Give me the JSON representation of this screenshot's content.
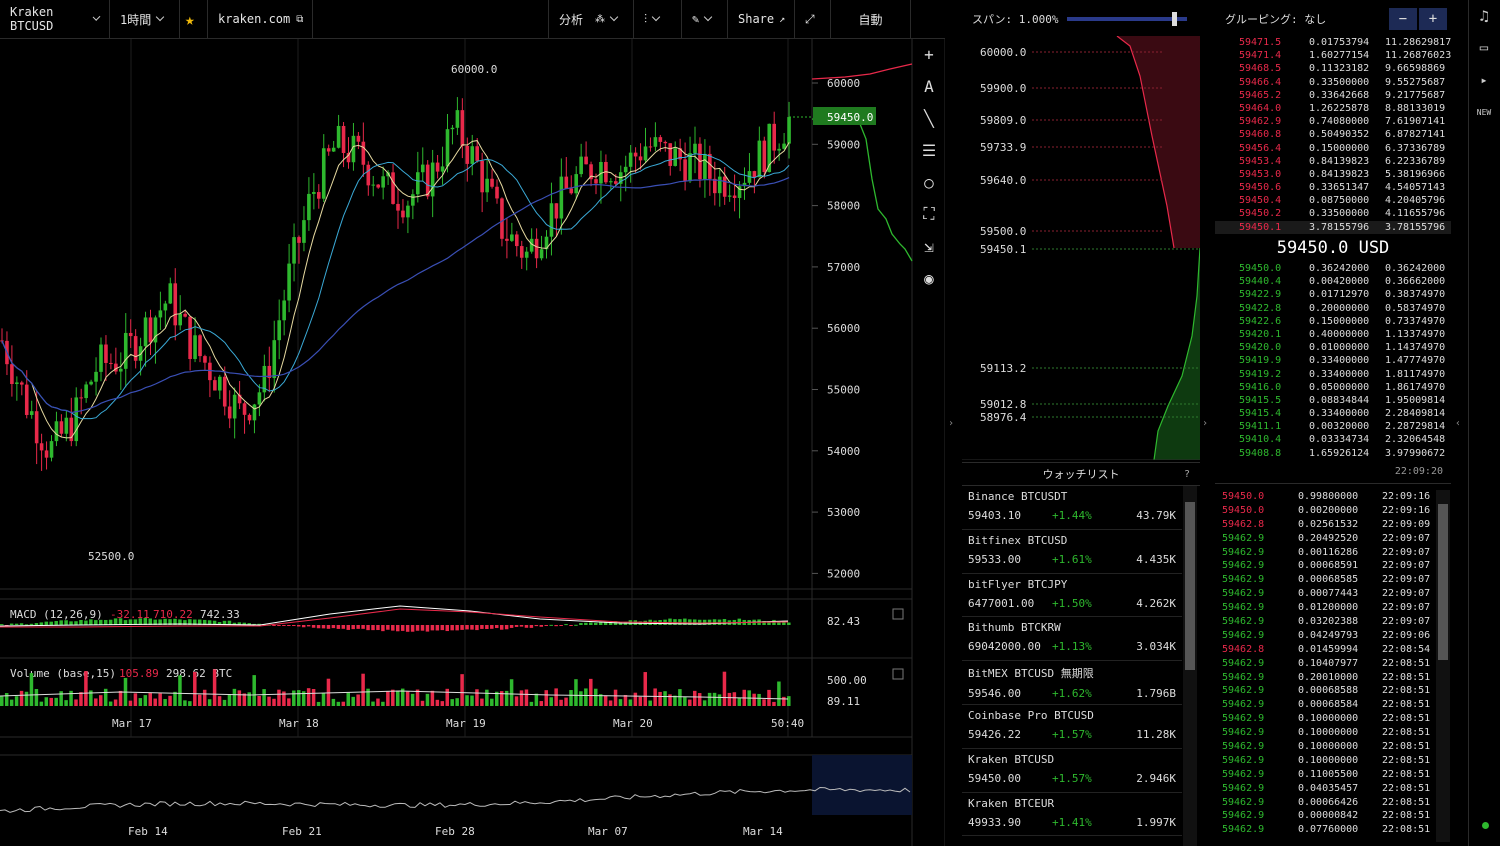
{
  "toolbar": {
    "symbol": "Kraken BTCUSD",
    "interval": "1時間",
    "source": "kraken.com",
    "analysis": "分析",
    "share": "Share",
    "auto": "自動"
  },
  "price_axis": [
    "60000",
    "59000",
    "58000",
    "57000",
    "56000",
    "55000",
    "54000",
    "53000",
    "52000"
  ],
  "last_price_tag": "59450.0",
  "high_label": "60000.0",
  "low_label": "52500.0",
  "macd": {
    "label": "MACD (12,26,9)",
    "v1": "-32.11",
    "v2": "710.22",
    "v3": "742.33",
    "axis": "82.43"
  },
  "volume": {
    "label": "Volume (base,15)",
    "v1": "105.89",
    "v2": "298.62 BTC",
    "axis1": "500.00",
    "axis2": "89.11"
  },
  "time_axis": [
    "Mar 17",
    "Mar 18",
    "Mar 19",
    "Mar 20",
    "50:40"
  ],
  "overview_axis": [
    "Feb 14",
    "Feb 21",
    "Feb 28",
    "Mar 07",
    "Mar 14"
  ],
  "depth": {
    "span_label": "スパン: 1.000%",
    "levels": [
      "60000.0",
      "59900.0",
      "59809.0",
      "59733.9",
      "59640.0",
      "59500.0",
      "59450.1",
      "59113.2",
      "59012.8",
      "58976.4"
    ]
  },
  "orderbook": {
    "grouping": "グルーピング: なし",
    "asks": [
      [
        "59471.5",
        "0.01753794",
        "11.28629817"
      ],
      [
        "59471.4",
        "1.60277154",
        "11.26876023"
      ],
      [
        "59468.5",
        "0.11323182",
        "9.66598869"
      ],
      [
        "59466.4",
        "0.33500000",
        "9.55275687"
      ],
      [
        "59465.2",
        "0.33642668",
        "9.21775687"
      ],
      [
        "59464.0",
        "1.26225878",
        "8.88133019"
      ],
      [
        "59462.9",
        "0.74080000",
        "7.61907141"
      ],
      [
        "59460.8",
        "0.50490352",
        "6.87827141"
      ],
      [
        "59456.4",
        "0.15000000",
        "6.37336789"
      ],
      [
        "59453.4",
        "0.84139823",
        "6.22336789"
      ],
      [
        "59453.0",
        "0.84139823",
        "5.38196966"
      ],
      [
        "59450.6",
        "0.33651347",
        "4.54057143"
      ],
      [
        "59450.4",
        "0.08750000",
        "4.20405796"
      ],
      [
        "59450.2",
        "0.33500000",
        "4.11655796"
      ],
      [
        "59450.1",
        "3.78155796",
        "3.78155796"
      ]
    ],
    "mid": "59450.0 USD",
    "bids": [
      [
        "59450.0",
        "0.36242000",
        "0.36242000"
      ],
      [
        "59440.4",
        "0.00420000",
        "0.36662000"
      ],
      [
        "59422.9",
        "0.01712970",
        "0.38374970"
      ],
      [
        "59422.8",
        "0.20000000",
        "0.58374970"
      ],
      [
        "59422.6",
        "0.15000000",
        "0.73374970"
      ],
      [
        "59420.1",
        "0.40000000",
        "1.13374970"
      ],
      [
        "59420.0",
        "0.01000000",
        "1.14374970"
      ],
      [
        "59419.9",
        "0.33400000",
        "1.47774970"
      ],
      [
        "59419.2",
        "0.33400000",
        "1.81174970"
      ],
      [
        "59416.0",
        "0.05000000",
        "1.86174970"
      ],
      [
        "59415.5",
        "0.08834844",
        "1.95009814"
      ],
      [
        "59415.4",
        "0.33400000",
        "2.28409814"
      ],
      [
        "59411.1",
        "0.00320000",
        "2.28729814"
      ],
      [
        "59410.4",
        "0.03334734",
        "2.32064548"
      ],
      [
        "59408.8",
        "1.65926124",
        "3.97990672"
      ]
    ],
    "time": "22:09:20"
  },
  "trades": [
    [
      "59450.0",
      "0.99800000",
      "22:09:16",
      "r"
    ],
    [
      "59450.0",
      "0.00200000",
      "22:09:16",
      "r"
    ],
    [
      "59462.8",
      "0.02561532",
      "22:09:09",
      "r"
    ],
    [
      "59462.9",
      "0.20492520",
      "22:09:07",
      "g"
    ],
    [
      "59462.9",
      "0.00116286",
      "22:09:07",
      "g"
    ],
    [
      "59462.9",
      "0.00068591",
      "22:09:07",
      "g"
    ],
    [
      "59462.9",
      "0.00068585",
      "22:09:07",
      "g"
    ],
    [
      "59462.9",
      "0.00077443",
      "22:09:07",
      "g"
    ],
    [
      "59462.9",
      "0.01200000",
      "22:09:07",
      "g"
    ],
    [
      "59462.9",
      "0.03202388",
      "22:09:07",
      "g"
    ],
    [
      "59462.9",
      "0.04249793",
      "22:09:06",
      "g"
    ],
    [
      "59462.8",
      "0.01459994",
      "22:08:54",
      "r"
    ],
    [
      "59462.9",
      "0.10407977",
      "22:08:51",
      "g"
    ],
    [
      "59462.9",
      "0.20010000",
      "22:08:51",
      "g"
    ],
    [
      "59462.9",
      "0.00068588",
      "22:08:51",
      "g"
    ],
    [
      "59462.9",
      "0.00068584",
      "22:08:51",
      "g"
    ],
    [
      "59462.9",
      "0.10000000",
      "22:08:51",
      "g"
    ],
    [
      "59462.9",
      "0.10000000",
      "22:08:51",
      "g"
    ],
    [
      "59462.9",
      "0.10000000",
      "22:08:51",
      "g"
    ],
    [
      "59462.9",
      "0.10000000",
      "22:08:51",
      "g"
    ],
    [
      "59462.9",
      "0.11005500",
      "22:08:51",
      "g"
    ],
    [
      "59462.9",
      "0.04035457",
      "22:08:51",
      "g"
    ],
    [
      "59462.9",
      "0.00066426",
      "22:08:51",
      "g"
    ],
    [
      "59462.9",
      "0.00000842",
      "22:08:51",
      "g"
    ],
    [
      "59462.9",
      "0.07760000",
      "22:08:51",
      "g"
    ]
  ],
  "watchlist": {
    "title": "ウォッチリスト",
    "help": "?",
    "items": [
      {
        "name": "Binance BTCUSDT",
        "price": "59403.10",
        "change": "+1.44%",
        "vol": "43.79K"
      },
      {
        "name": "Bitfinex BTCUSD",
        "price": "59533.00",
        "change": "+1.61%",
        "vol": "4.435K"
      },
      {
        "name": "bitFlyer BTCJPY",
        "price": "6477001.00",
        "change": "+1.50%",
        "vol": "4.262K"
      },
      {
        "name": "Bithumb BTCKRW",
        "price": "69042000.00",
        "change": "+1.13%",
        "vol": "3.034K"
      },
      {
        "name": "BitMEX BTCUSD 無期限",
        "price": "59546.00",
        "change": "+1.62%",
        "vol": "1.796B"
      },
      {
        "name": "Coinbase Pro BTCUSD",
        "price": "59426.22",
        "change": "+1.57%",
        "vol": "11.28K"
      },
      {
        "name": "Kraken BTCUSD",
        "price": "59450.00",
        "change": "+1.57%",
        "vol": "2.946K"
      },
      {
        "name": "Kraken BTCEUR",
        "price": "49933.90",
        "change": "+1.41%",
        "vol": "1.997K"
      }
    ]
  },
  "colors": {
    "up": "#2eb82e",
    "down": "#e8294a",
    "accent": "#1f7a1f"
  }
}
